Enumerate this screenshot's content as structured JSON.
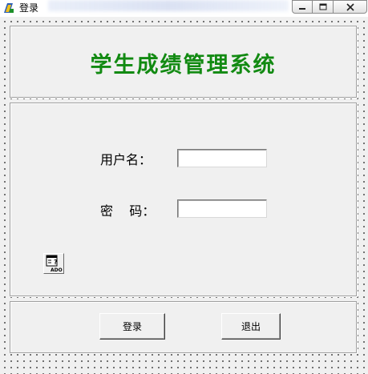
{
  "window": {
    "title": "登录"
  },
  "header": {
    "system_title": "学生成绩管理系统"
  },
  "form": {
    "username_label": "用户名：",
    "username_value": "",
    "password_label": "密    码：",
    "password_value": ""
  },
  "ado_control": {
    "caption": "ADO"
  },
  "buttons": {
    "login_label": "登录",
    "exit_label": "退出"
  },
  "colors": {
    "title_green": "#128a12"
  },
  "icons": {
    "app": "vb-app-icon",
    "minimize": "minimize-icon",
    "maximize": "maximize-icon",
    "close": "close-icon",
    "ado": "ado-data-control-icon"
  }
}
